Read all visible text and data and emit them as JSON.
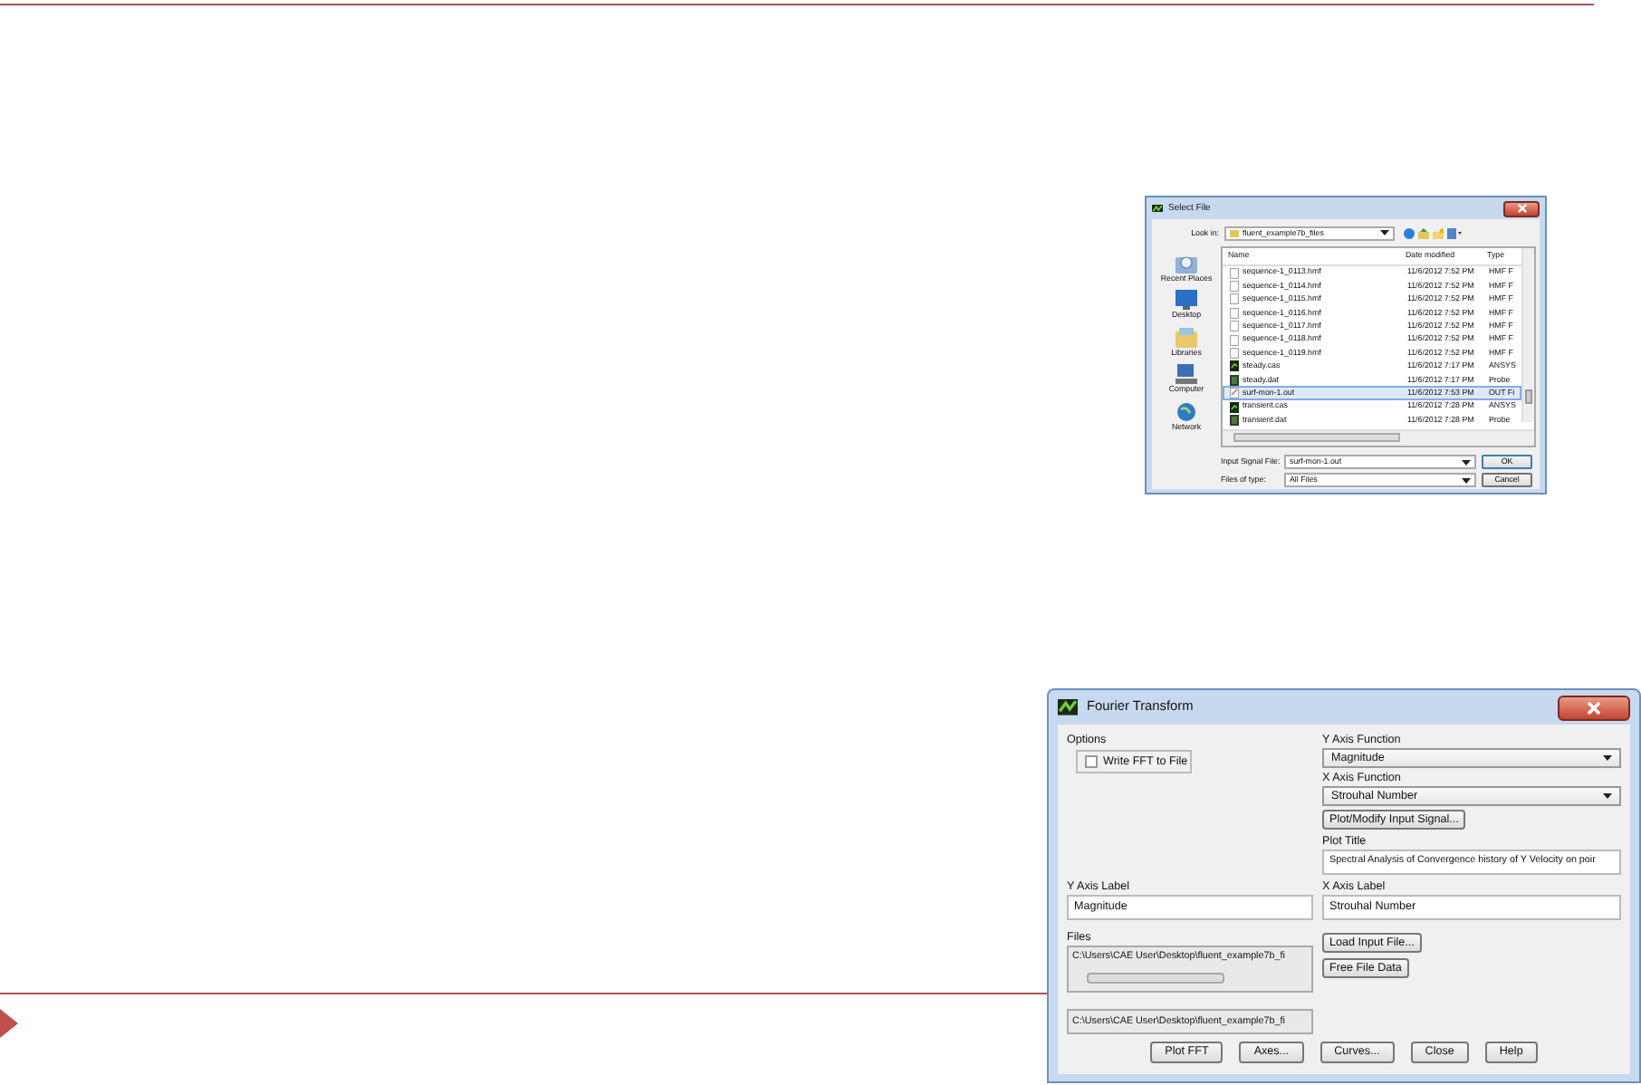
{
  "select_file": {
    "title": "Select File",
    "look_in_label": "Look in:",
    "look_in_value": "fluent_example7b_files",
    "places": [
      {
        "kind": "recent",
        "label": "Recent Places"
      },
      {
        "kind": "desktop",
        "label": "Desktop"
      },
      {
        "kind": "libraries",
        "label": "Libraries"
      },
      {
        "kind": "computer",
        "label": "Computer"
      },
      {
        "kind": "network",
        "label": "Network"
      }
    ],
    "columns": [
      "Name",
      "Date modified",
      "Type"
    ],
    "rows": [
      {
        "kind": "hmf",
        "name": "sequence-1_0113.hmf",
        "date": "11/6/2012 7:52 PM",
        "type": "HMF F",
        "selected": false
      },
      {
        "kind": "hmf",
        "name": "sequence-1_0114.hmf",
        "date": "11/6/2012 7:52 PM",
        "type": "HMF F",
        "selected": false
      },
      {
        "kind": "hmf",
        "name": "sequence-1_0115.hmf",
        "date": "11/6/2012 7:52 PM",
        "type": "HMF F",
        "selected": false
      },
      {
        "kind": "hmf",
        "name": "sequence-1_0116.hmf",
        "date": "11/6/2012 7:52 PM",
        "type": "HMF F",
        "selected": false
      },
      {
        "kind": "hmf",
        "name": "sequence-1_0117.hmf",
        "date": "11/6/2012 7:52 PM",
        "type": "HMF F",
        "selected": false
      },
      {
        "kind": "hmf",
        "name": "sequence-1_0118.hmf",
        "date": "11/6/2012 7:52 PM",
        "type": "HMF F",
        "selected": false
      },
      {
        "kind": "hmf",
        "name": "sequence-1_0119.hmf",
        "date": "11/6/2012 7:52 PM",
        "type": "HMF F",
        "selected": false
      },
      {
        "kind": "cas",
        "name": "steady.cas",
        "date": "11/6/2012 7:17 PM",
        "type": "ANSYS",
        "selected": false
      },
      {
        "kind": "dat",
        "name": "steady.dat",
        "date": "11/6/2012 7:17 PM",
        "type": "Probe",
        "selected": false
      },
      {
        "kind": "out",
        "name": "surf-mon-1.out",
        "date": "11/6/2012 7:53 PM",
        "type": "OUT Fi",
        "selected": true
      },
      {
        "kind": "cas",
        "name": "transient.cas",
        "date": "11/6/2012 7:28 PM",
        "type": "ANSYS",
        "selected": false
      },
      {
        "kind": "dat",
        "name": "transient.dat",
        "date": "11/6/2012 7:28 PM",
        "type": "Probe",
        "selected": false
      }
    ],
    "input_label": "Input Signal File:",
    "input_value": "surf-mon-1.out",
    "type_label": "Files of type:",
    "type_value": "All Files",
    "buttons": [
      "OK",
      "Cancel"
    ]
  },
  "fourier": {
    "title": "Fourier Transform",
    "options_label": "Options",
    "write_fft": {
      "label": "Write FFT to File",
      "checked": false
    },
    "y_function_label": "Y Axis Function",
    "y_function_value": "Magnitude",
    "x_function_label": "X Axis Function",
    "x_function_value": "Strouhal Number",
    "plot_modify_button": "Plot/Modify Input Signal...",
    "plot_title_label": "Plot Title",
    "plot_title_value": "Spectral Analysis of Convergence history of Y Velocity on poir",
    "y_label_label": "Y Axis Label",
    "y_label_value": "Magnitude",
    "x_label_label": "X Axis Label",
    "x_label_value": "Strouhal Number",
    "files_label": "Files",
    "files": [
      "C:\\Users\\CAE User\\Desktop\\fluent_example7b_fi"
    ],
    "load_button": "Load Input File...",
    "free_button": "Free File Data",
    "path_value": "C:\\Users\\CAE User\\Desktop\\fluent_example7b_fi",
    "buttons": [
      "Plot FFT",
      "Axes...",
      "Curves...",
      "Close",
      "Help"
    ]
  }
}
